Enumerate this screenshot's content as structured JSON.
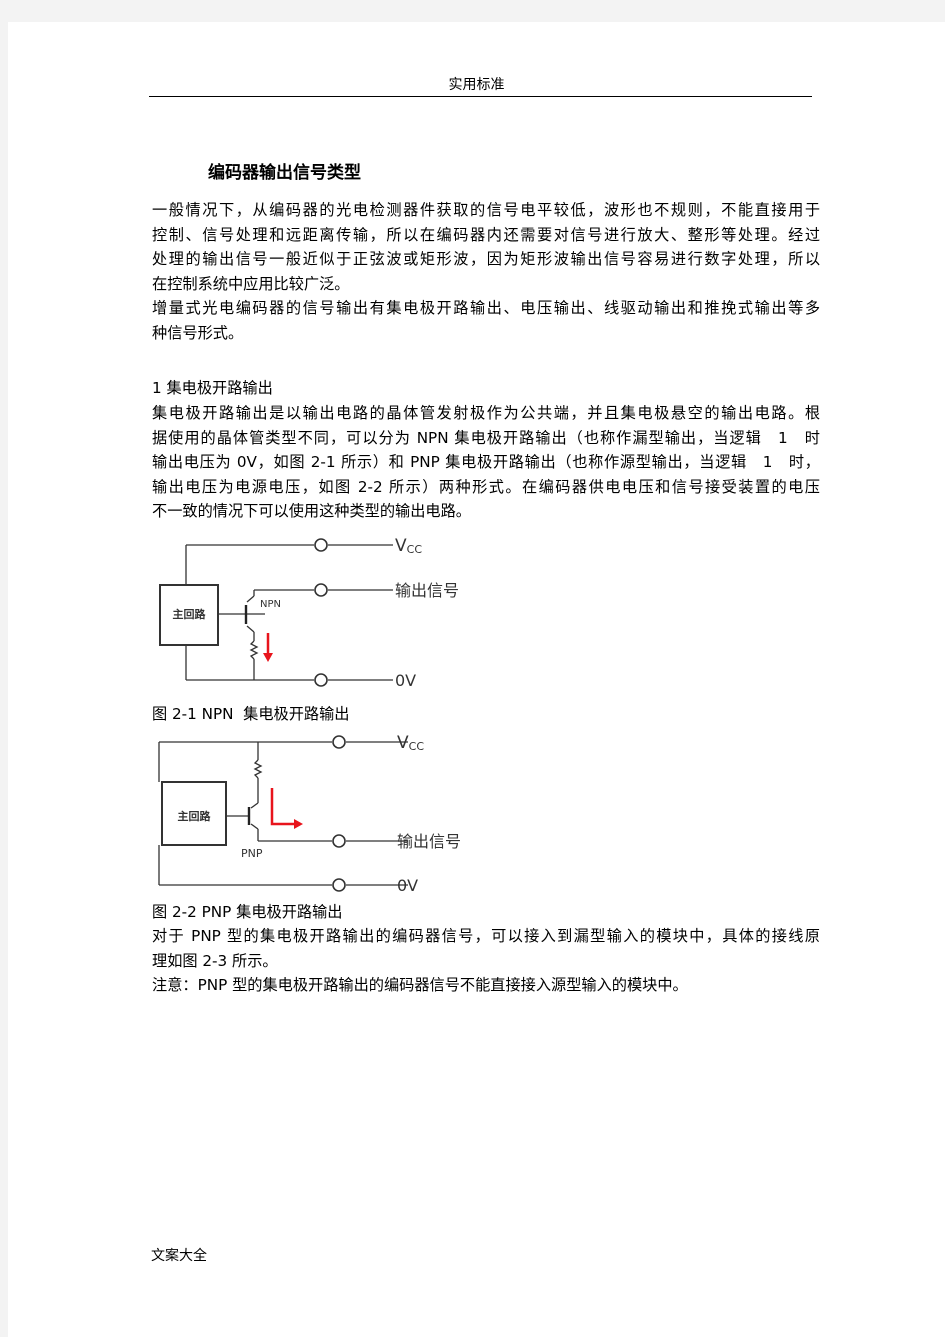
{
  "header": {
    "text": "实用标准"
  },
  "title": "编码器输出信号类型",
  "intro": {
    "lines": [
      "一般情况下，从编码器的光电检测器件获取的信号电平较低，波形也不规则，不能直接用于",
      "控制、信号处理和远距离传输，所以在编码器内还需要对信号进行放大、整形等处理。经过",
      "处理的输出信号一般近似于正弦波或矩形波，因为矩形波输出信号容易进行数字处理，所以",
      "在控制系统中应用比较广泛。",
      "增量式光电编码器的信号输出有集电极开路输出、电压输出、线驱动输出和推挽式输出等多",
      "种信号形式。"
    ]
  },
  "section1": {
    "heading": "1 集电极开路输出",
    "lines": [
      "集电极开路输出是以输出电路的晶体管发射极作为公共端，并且集电极悬空的输出电路。根",
      "据使用的晶体管类型不同，可以分为 NPN 集电极开路输出（也称作漏型输出，当逻辑　1　时",
      "输出电压为 0V，如图 2-1 所示）和 PNP 集电极开路输出（也称作源型输出，当逻辑　1　时，",
      "输出电压为电源电压，如图 2-2 所示）两种形式。在编码器供电电压和信号接受装置的电压",
      "不一致的情况下可以使用这种类型的输出电路。"
    ]
  },
  "figure1": {
    "block_label": "主回路",
    "transistor_label": "NPN",
    "terminals": {
      "vcc_main": "V",
      "vcc_sub": "CC",
      "signal": "输出信号",
      "zero": "0V"
    },
    "caption": "图 2-1 NPN  集电极开路输出",
    "arrow_color": "#e8141c"
  },
  "figure2": {
    "block_label": "主回路",
    "transistor_label": "PNP",
    "terminals": {
      "vcc_main": "V",
      "vcc_sub": "CC",
      "signal": "输出信号",
      "zero": "0V"
    },
    "caption": "图 2-2 PNP 集电极开路输出",
    "arrow_color": "#e8141c"
  },
  "after": {
    "lines": [
      "对于 PNP 型的集电极开路输出的编码器信号，可以接入到漏型输入的模块中，具体的接线原",
      "理如图 2-3 所示。",
      "注意：PNP 型的集电极开路输出的编码器信号不能直接接入源型输入的模块中。"
    ]
  },
  "footer": {
    "text": "文案大全"
  }
}
